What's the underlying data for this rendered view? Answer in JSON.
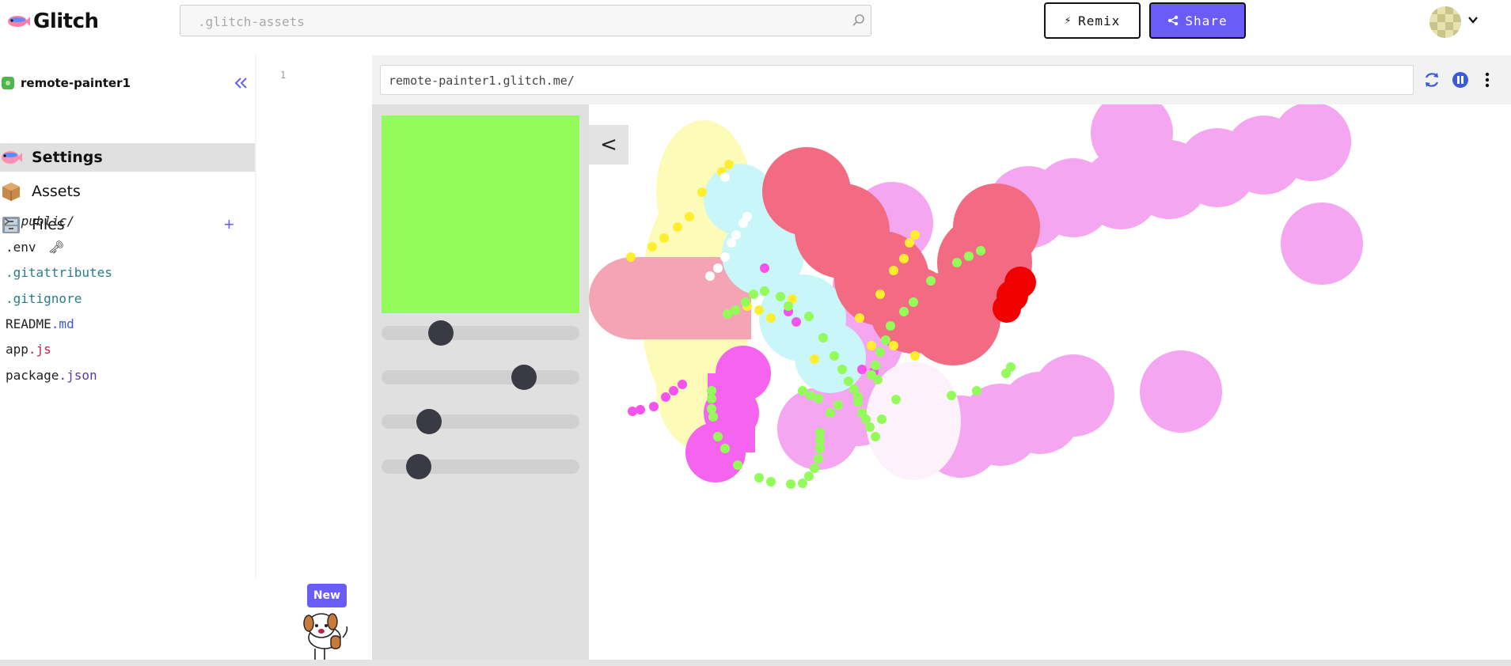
{
  "header": {
    "logo_text": "Glitch",
    "search_placeholder": ".glitch-assets",
    "remix_label": "Remix",
    "share_label": "Share"
  },
  "sidebar": {
    "project_name": "remote-painter1",
    "nav": {
      "settings": "Settings",
      "assets": "Assets",
      "files": "Files",
      "add_symbol": "+"
    },
    "files": [
      {
        "name": ".env",
        "marker": "🗝"
      },
      {
        "name": ".gitattributes"
      },
      {
        "name": ".gitignore"
      },
      {
        "base": "README",
        "ext": ".md"
      },
      {
        "base": "app",
        "ext": ".js"
      },
      {
        "base": "package",
        "ext": ".json"
      }
    ],
    "folder": "public/"
  },
  "editor": {
    "line_number": "1"
  },
  "preview": {
    "url": "remote-painter1.glitch.me/",
    "toggle_label": "<",
    "swatch_color": "#94fc5a",
    "sliders": [
      {
        "name": "slider-1",
        "value": 0.27
      },
      {
        "name": "slider-2",
        "value": 0.75
      },
      {
        "name": "slider-3",
        "value": 0.2
      },
      {
        "name": "slider-4",
        "value": 0.14
      }
    ]
  },
  "mascot": {
    "badge": "New"
  },
  "colors": {
    "accent": "#6a5df7",
    "selected_row": "#e0e0e0"
  }
}
